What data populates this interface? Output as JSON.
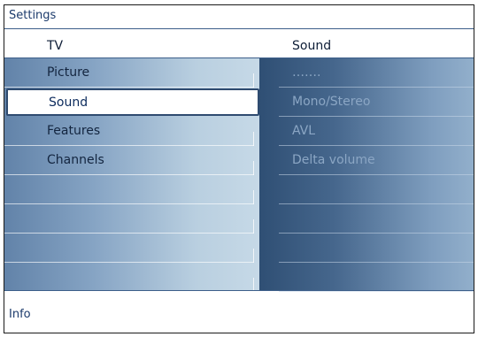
{
  "window": {
    "title": "Settings"
  },
  "columns": {
    "left_header": "TV",
    "right_header": "Sound"
  },
  "menu": {
    "items": [
      {
        "label": "Picture",
        "selected": false
      },
      {
        "label": "Sound",
        "selected": true
      },
      {
        "label": "Features",
        "selected": false
      },
      {
        "label": "Channels",
        "selected": false
      },
      {
        "label": "",
        "selected": false
      },
      {
        "label": "",
        "selected": false
      },
      {
        "label": "",
        "selected": false
      },
      {
        "label": "",
        "selected": false
      }
    ]
  },
  "submenu": {
    "items": [
      {
        "label": "……."
      },
      {
        "label": "Mono/Stereo"
      },
      {
        "label": "AVL"
      },
      {
        "label": "Delta volume"
      },
      {
        "label": ""
      },
      {
        "label": ""
      },
      {
        "label": ""
      },
      {
        "label": ""
      }
    ]
  },
  "footer": {
    "info_label": "Info"
  },
  "colors": {
    "accent": "#1b3a6b",
    "selection_border": "#2f4b70"
  }
}
